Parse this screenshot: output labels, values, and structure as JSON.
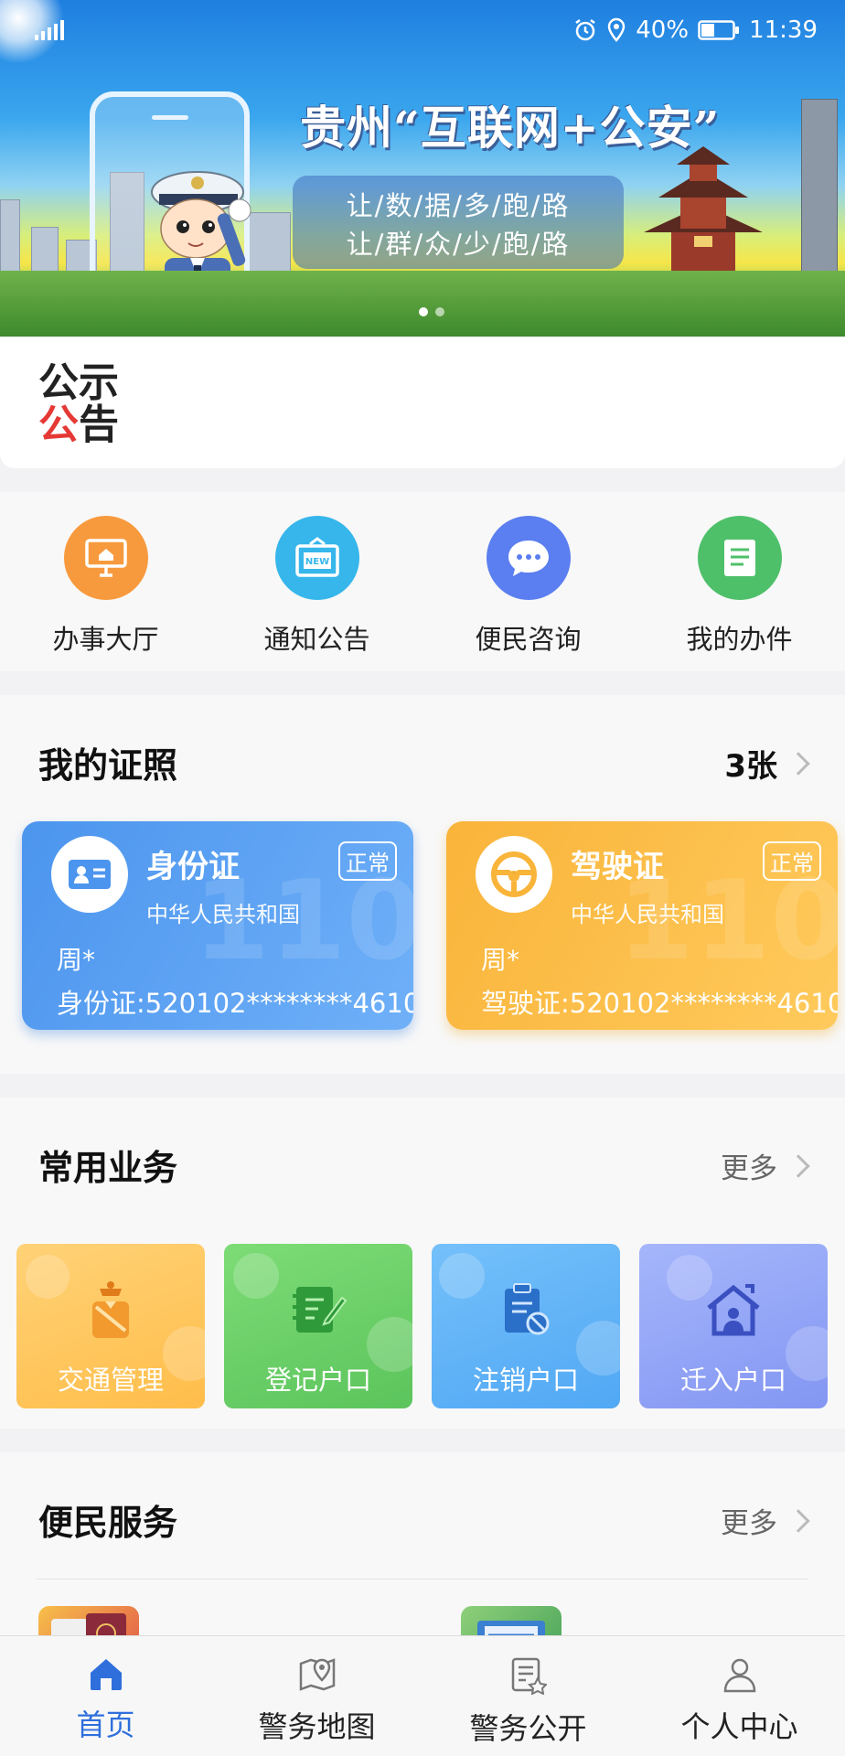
{
  "status_bar": {
    "battery": "40%",
    "time": "11:39"
  },
  "banner": {
    "title": "贵州“互联网+公安”",
    "slogan_line1": "让/数/据/多/跑/路",
    "slogan_line2": "让/群/众/少/跑/路"
  },
  "notice": {
    "logo_line1": "公示",
    "logo_red": "公",
    "logo_black": "告"
  },
  "quick_entries": [
    {
      "label": "办事大厅",
      "icon": "monitor-home-icon",
      "color": "#f79a3e"
    },
    {
      "label": "通知公告",
      "icon": "new-notice-icon",
      "color": "#36b6ea"
    },
    {
      "label": "便民咨询",
      "icon": "chat-bubble-icon",
      "color": "#5b7ff0"
    },
    {
      "label": "我的办件",
      "icon": "document-icon",
      "color": "#4fc06a"
    }
  ],
  "licenses": {
    "title": "我的证照",
    "count": "3张",
    "cards": [
      {
        "name": "身份证",
        "status": "正常",
        "issuer": "中华人民共和国",
        "holder": "周*",
        "number": "身份证:520102********4610"
      },
      {
        "name": "驾驶证",
        "status": "正常",
        "issuer": "中华人民共和国",
        "holder": "周*",
        "number": "驾驶证:520102********4610"
      }
    ]
  },
  "business": {
    "title": "常用业务",
    "more": "更多",
    "tiles": [
      {
        "label": "交通管理",
        "icon": "traffic-officer-icon",
        "color": "#ffc658"
      },
      {
        "label": "登记户口",
        "icon": "register-notebook-icon",
        "color": "#6ccf6a"
      },
      {
        "label": "注销户口",
        "icon": "cancel-clipboard-icon",
        "color": "#5fb2f7"
      },
      {
        "label": "迁入户口",
        "icon": "house-person-icon",
        "color": "#8ea4f6"
      }
    ]
  },
  "convenience": {
    "title": "便民服务",
    "more": "更多"
  },
  "tabbar": [
    {
      "label": "首页",
      "icon": "home-icon",
      "active": true
    },
    {
      "label": "警务地图",
      "icon": "map-pin-icon",
      "active": false
    },
    {
      "label": "警务公开",
      "icon": "document-star-icon",
      "active": false
    },
    {
      "label": "个人中心",
      "icon": "user-icon",
      "active": false
    }
  ]
}
